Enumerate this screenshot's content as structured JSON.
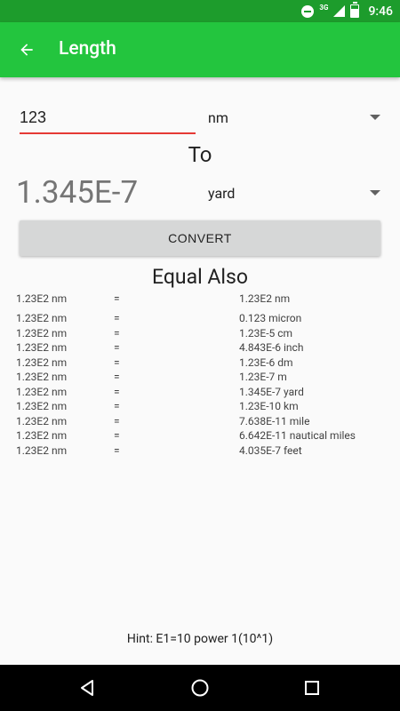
{
  "status_bar": {
    "time": "9:46",
    "network": "3G"
  },
  "app_bar": {
    "title": "Length",
    "back_icon": "arrow-back-icon"
  },
  "input": {
    "value": "123",
    "unit": "nm"
  },
  "to_label": "To",
  "result": {
    "value": "1.345E-7",
    "unit": "yard"
  },
  "convert_label": "CONVERT",
  "equal_also_label": "Equal Also",
  "equivalents": [
    {
      "from": "1.23E2 nm",
      "eq": "=",
      "to": "1.23E2 nm"
    },
    {
      "from": "1.23E2 nm",
      "eq": "=",
      "to": "0.123 micron"
    },
    {
      "from": "1.23E2 nm",
      "eq": "=",
      "to": "1.23E-5 cm"
    },
    {
      "from": "1.23E2 nm",
      "eq": "=",
      "to": "4.843E-6 inch"
    },
    {
      "from": "1.23E2 nm",
      "eq": "=",
      "to": "1.23E-6 dm"
    },
    {
      "from": "1.23E2 nm",
      "eq": "=",
      "to": "1.23E-7 m"
    },
    {
      "from": "1.23E2 nm",
      "eq": "=",
      "to": "1.345E-7 yard"
    },
    {
      "from": "1.23E2 nm",
      "eq": "=",
      "to": "1.23E-10 km"
    },
    {
      "from": "1.23E2 nm",
      "eq": "=",
      "to": "7.638E-11 mile"
    },
    {
      "from": "1.23E2 nm",
      "eq": "=",
      "to": "6.642E-11 nautical miles"
    },
    {
      "from": "1.23E2 nm",
      "eq": "=",
      "to": "4.035E-7 feet"
    }
  ],
  "hint": "Hint: E1=10 power 1(10^1)",
  "colors": {
    "status_bar": "#1d9c2c",
    "app_bar": "#23c53e",
    "input_underline": "#e53935",
    "button_bg": "#d6d7d7"
  }
}
